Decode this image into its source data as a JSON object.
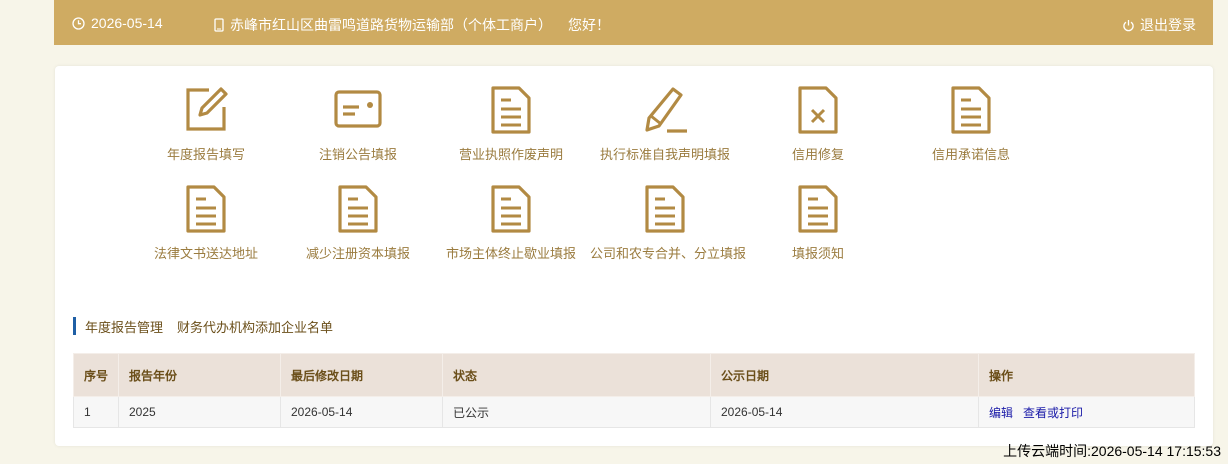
{
  "header": {
    "date": "2026-05-14",
    "company": "赤峰市红山区曲雷鸣道路货物运输部（个体工商户）",
    "greeting": "您好！",
    "logout": "退出登录"
  },
  "tiles_row1": [
    {
      "label": "年度报告填写",
      "icon": "edit-icon"
    },
    {
      "label": "注销公告填报",
      "icon": "card-icon"
    },
    {
      "label": "营业执照作废声明",
      "icon": "document-icon"
    },
    {
      "label": "执行标准自我声明填报",
      "icon": "pencil-icon"
    },
    {
      "label": "信用修复",
      "icon": "document-x-icon"
    },
    {
      "label": "信用承诺信息",
      "icon": "document-icon"
    }
  ],
  "tiles_row2": [
    {
      "label": "法律文书送达地址",
      "icon": "document-icon"
    },
    {
      "label": "减少注册资本填报",
      "icon": "document-icon"
    },
    {
      "label": "市场主体终止歇业填报",
      "icon": "document-icon"
    },
    {
      "label": "公司和农专合并、分立填报",
      "icon": "document-icon"
    },
    {
      "label": "填报须知",
      "icon": "document-icon"
    }
  ],
  "section": {
    "tab_active": "年度报告管理",
    "tab_other": "财务代办机构添加企业名单"
  },
  "table": {
    "headers": [
      "序号",
      "报告年份",
      "最后修改日期",
      "状态",
      "公示日期",
      "操作"
    ],
    "rows": [
      {
        "seq": "1",
        "year": "2025",
        "modified": "2026-05-14",
        "status": "已公示",
        "published": "2026-05-14",
        "actions": [
          "编辑",
          "查看或打印"
        ]
      }
    ]
  },
  "footer": {
    "upload_time": "上传云端时间:2026-05-14 17:15:53"
  },
  "colors": {
    "header_bg": "#cfab62",
    "icon": "#b28a43",
    "accent_bar": "#1f5fa5",
    "link": "#1a1aa8"
  }
}
